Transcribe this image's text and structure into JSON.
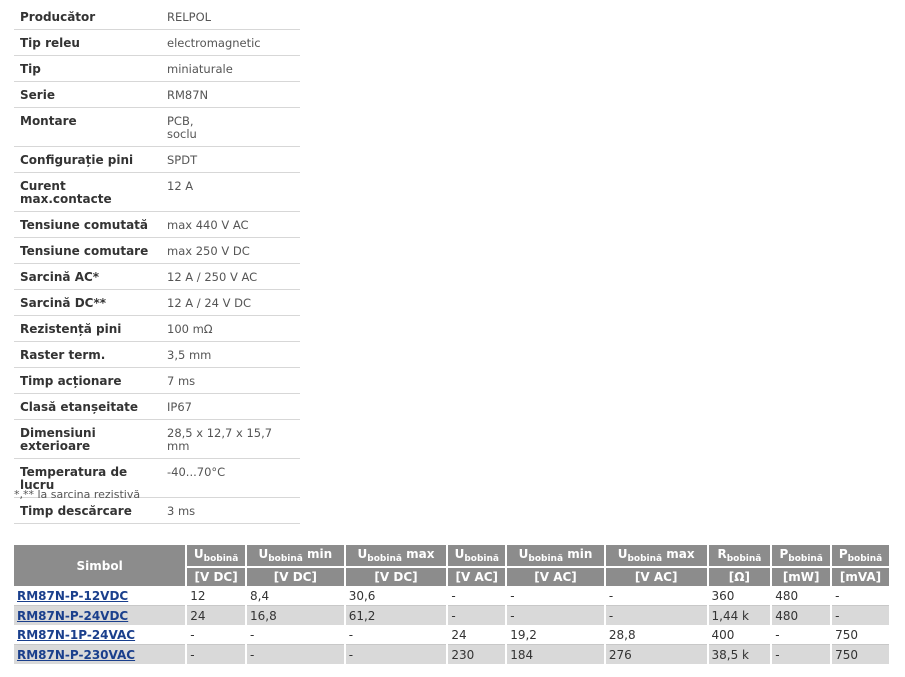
{
  "specs": [
    {
      "label": "Producător",
      "value": "RELPOL"
    },
    {
      "label": "Tip releu",
      "value": "electromagnetic"
    },
    {
      "label": "Tip",
      "value": "miniaturale"
    },
    {
      "label": "Serie",
      "value": "RM87N"
    },
    {
      "label": "Montare",
      "value": "PCB,",
      "value2": "soclu"
    },
    {
      "label": "Configurație pini",
      "value": "SPDT"
    },
    {
      "label": "Curent max.contacte",
      "value": "12 A"
    },
    {
      "label": "Tensiune comutată",
      "value": "max 440 V AC"
    },
    {
      "label": "Tensiune comutare",
      "value": "max 250 V DC"
    },
    {
      "label": "Sarcină AC*",
      "value": "12 A / 250 V AC"
    },
    {
      "label": "Sarcină DC**",
      "value": "12 A / 24 V DC"
    },
    {
      "label": "Rezistență pini",
      "value": "100 mΩ"
    },
    {
      "label": "Raster term.",
      "value": "3,5 mm"
    },
    {
      "label": "Timp acționare",
      "value": "7 ms"
    },
    {
      "label": "Clasă etanșeitate",
      "value": "IP67"
    },
    {
      "label": "Dimensiuni exterioare",
      "value": "28,5 x 12,7 x 15,7 mm"
    },
    {
      "label": "Temperatura de lucru",
      "value": "-40...70°C"
    },
    {
      "label": "Timp descărcare",
      "value": "3 ms"
    }
  ],
  "note": "*,** la sarcina rezistivă",
  "products": {
    "headers": [
      {
        "main": "Simbol",
        "sub": "",
        "suffix": "",
        "unit": ""
      },
      {
        "main": "U",
        "sub": "bobină",
        "suffix": "",
        "unit": "[V DC]"
      },
      {
        "main": "U",
        "sub": "bobină",
        "suffix": " min",
        "unit": "[V DC]"
      },
      {
        "main": "U",
        "sub": "bobină",
        "suffix": " max",
        "unit": "[V DC]"
      },
      {
        "main": "U",
        "sub": "bobină",
        "suffix": "",
        "unit": "[V AC]"
      },
      {
        "main": "U",
        "sub": "bobină",
        "suffix": " min",
        "unit": "[V AC]"
      },
      {
        "main": "U",
        "sub": "bobină",
        "suffix": " max",
        "unit": "[V AC]"
      },
      {
        "main": "R",
        "sub": "bobină",
        "suffix": "",
        "unit": "[Ω]"
      },
      {
        "main": "P",
        "sub": "bobină",
        "suffix": "",
        "unit": "[mW]"
      },
      {
        "main": "P",
        "sub": "bobină",
        "suffix": "",
        "unit": "[mVA]"
      }
    ],
    "rows": [
      [
        "RM87N-P-12VDC",
        "12",
        "8,4",
        "30,6",
        "-",
        "-",
        "-",
        "360",
        "480",
        "-"
      ],
      [
        "RM87N-P-24VDC",
        "24",
        "16,8",
        "61,2",
        "-",
        "-",
        "-",
        "1,44 k",
        "480",
        "-"
      ],
      [
        "RM87N-1P-24VAC",
        "-",
        "-",
        "-",
        "24",
        "19,2",
        "28,8",
        "400",
        "-",
        "750"
      ],
      [
        "RM87N-P-230VAC",
        "-",
        "-",
        "-",
        "230",
        "184",
        "276",
        "38,5 k",
        "-",
        "750"
      ]
    ]
  }
}
